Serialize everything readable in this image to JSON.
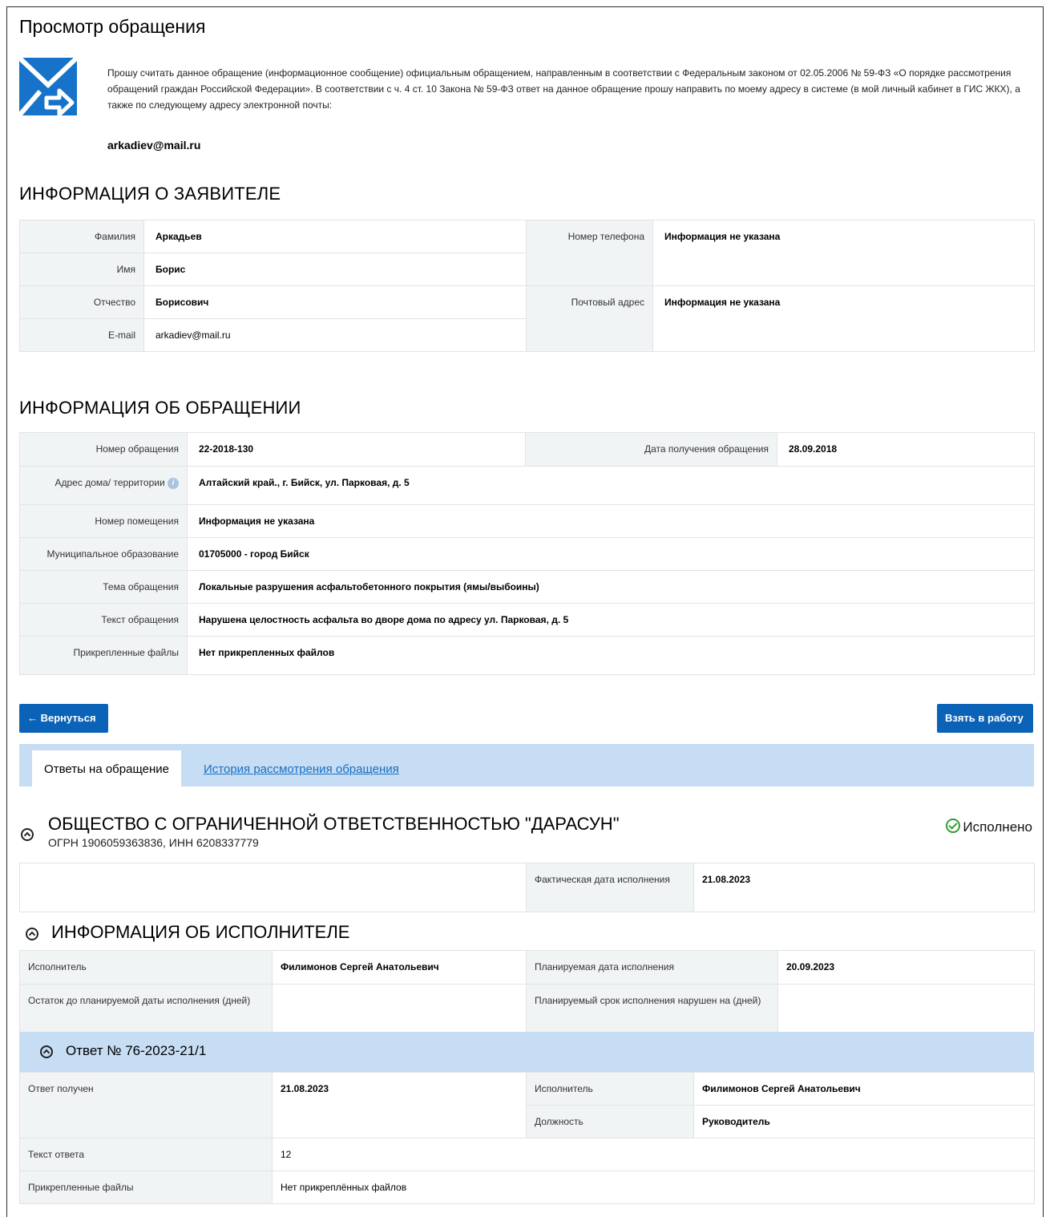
{
  "page_title": "Просмотр обращения",
  "intro": {
    "text": "Прошу считать данное обращение (информационное сообщение) официальным обращением, направленным в соответствии с Федеральным законом от 02.05.2006 № 59-ФЗ «О порядке рассмотрения обращений граждан Российской Федерации». В соответствии с ч. 4 ст. 10 Закона № 59-ФЗ ответ на данное обращение прошу направить по моему адресу в системе (в мой личный кабинет в ГИС ЖКХ), а также по следующему адресу электронной почты:",
    "email": "arkadiev@mail.ru",
    "icon": "envelope-arrow-icon"
  },
  "applicant": {
    "heading": "ИНФОРМАЦИЯ О ЗАЯВИТЕЛЕ",
    "surname_label": "Фамилия",
    "surname": "Аркадьев",
    "name_label": "Имя",
    "name": "Борис",
    "patronymic_label": "Отчество",
    "patronymic": "Борисович",
    "email_label": "E-mail",
    "email": "arkadiev@mail.ru",
    "phone_label": "Номер телефона",
    "phone": "Информация не указана",
    "postal_label": "Почтовый адрес",
    "postal": "Информация не указана"
  },
  "appeal": {
    "heading": "ИНФОРМАЦИЯ ОБ ОБРАЩЕНИИ",
    "number_label": "Номер обращения",
    "number": "22-2018-130",
    "date_label": "Дата получения обращения",
    "date": "28.09.2018",
    "address_label": "Адрес дома/ территории",
    "address": "Алтайский край., г. Бийск, ул. Парковая, д. 5",
    "room_label": "Номер помещения",
    "room": "Информация не указана",
    "municipality_label": "Муниципальное образование",
    "municipality": "01705000 - город Бийск",
    "topic_label": "Тема обращения",
    "topic": "Локальные разрушения асфальтобетонного покрытия (ямы/выбоины)",
    "text_label": "Текст обращения",
    "text": "Нарушена целостность асфальта во дворе дома по адресу ул. Парковая, д. 5",
    "files_label": "Прикрепленные файлы",
    "files": "Нет прикрепленных файлов"
  },
  "actions": {
    "back": "← Вернуться",
    "take": "Взять в работу"
  },
  "tabs": {
    "answers": "Ответы на обращение",
    "history": "История рассмотрения обращения"
  },
  "org": {
    "name": "ОБЩЕСТВО С ОГРАНИЧЕННОЙ ОТВЕТСТВЕННОСТЬЮ \"ДАРАСУН\"",
    "ids": "ОГРН 1906059363836, ИНН 6208337779",
    "status": "Исполнено",
    "status_color": "#2e9e2e",
    "actual_date_label": "Фактическая дата исполнения",
    "actual_date": "21.08.2023"
  },
  "executor": {
    "heading": "ИНФОРМАЦИЯ ОБ ИСПОЛНИТЕЛЕ",
    "executor_label": "Исполнитель",
    "executor": "Филимонов Сергей Анатольевич",
    "planned_date_label": "Планируемая дата исполнения",
    "planned_date": "20.09.2023",
    "remaining_label": "Остаток до планируемой даты исполнения (дней)",
    "remaining": "",
    "overdue_label": "Планируемый срок исполнения нарушен на (дней)",
    "overdue": ""
  },
  "answer": {
    "title": "Ответ № 76-2023-21/1",
    "received_label": "Ответ получен",
    "received": "21.08.2023",
    "executor_label": "Исполнитель",
    "executor": "Филимонов Сергей Анатольевич",
    "position_label": "Должность",
    "position": "Руководитель",
    "text_label": "Текст ответа",
    "text": "12",
    "files_label": "Прикрепленные файлы",
    "files": "Нет прикреплённых файлов"
  }
}
